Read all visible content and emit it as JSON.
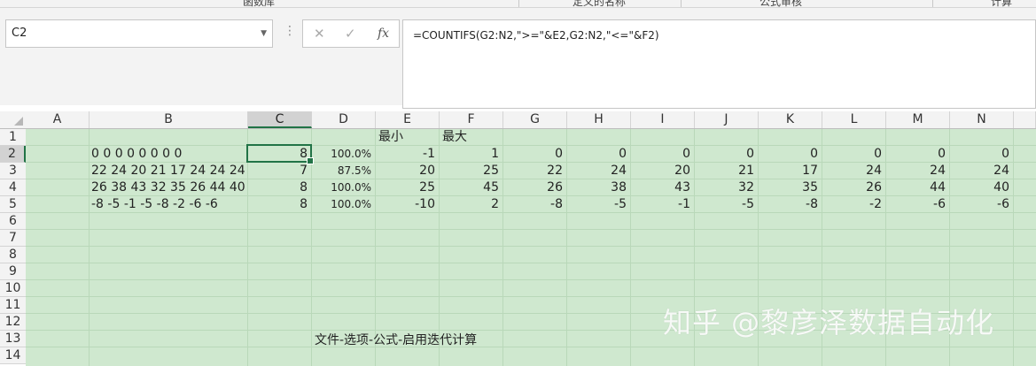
{
  "ribbon": {
    "groups": [
      "函数库",
      "定义的名称",
      "公式审核",
      "计算"
    ]
  },
  "formula_bar": {
    "name_box": "C2",
    "cancel_icon": "✕",
    "enter_icon": "✓",
    "fx_label": "fx",
    "formula": "=COUNTIFS(G2:N2,\">=\"&E2,G2:N2,\"<=\"&F2)"
  },
  "columns": [
    "A",
    "B",
    "C",
    "D",
    "E",
    "F",
    "G",
    "H",
    "I",
    "J",
    "K",
    "L",
    "M",
    "N"
  ],
  "selected_column": "C",
  "rows": [
    "1",
    "2",
    "3",
    "4",
    "5",
    "6",
    "7",
    "8",
    "9",
    "10",
    "11",
    "12",
    "13",
    "14"
  ],
  "selected_row": "2",
  "headers": {
    "E1": "最小",
    "F1": "最大"
  },
  "data_rows": [
    {
      "b": "0 0 0 0 0 0 0 0",
      "c": "8",
      "d": "100.0%",
      "e": "-1",
      "f": "1",
      "g": "0",
      "h": "0",
      "i": "0",
      "j": "0",
      "k": "0",
      "l": "0",
      "m": "0",
      "n": "0"
    },
    {
      "b": "22 24 20 21 17 24 24 24",
      "c": "7",
      "d": "87.5%",
      "e": "20",
      "f": "25",
      "g": "22",
      "h": "24",
      "i": "20",
      "j": "21",
      "k": "17",
      "l": "24",
      "m": "24",
      "n": "24"
    },
    {
      "b": "26 38 43 32 35 26 44 40",
      "c": "8",
      "d": "100.0%",
      "e": "25",
      "f": "45",
      "g": "26",
      "h": "38",
      "i": "43",
      "j": "32",
      "k": "35",
      "l": "26",
      "m": "44",
      "n": "40"
    },
    {
      "b": "-8 -5 -1 -5 -8 -2 -6 -6",
      "c": "8",
      "d": "100.0%",
      "e": "-10",
      "f": "2",
      "g": "-8",
      "h": "-5",
      "i": "-1",
      "j": "-5",
      "k": "-8",
      "l": "-2",
      "m": "-6",
      "n": "-6"
    }
  ],
  "note": "文件-选项-公式-启用迭代计算",
  "watermark": "知乎 @黎彦泽数据自动化",
  "colors": {
    "sheet_bg": "#cfe8cf",
    "accent": "#217346"
  }
}
